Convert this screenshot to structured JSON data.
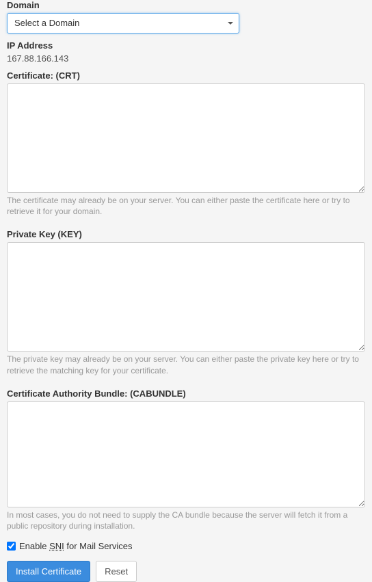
{
  "domain": {
    "label": "Domain",
    "placeholder": "Select a Domain"
  },
  "ip": {
    "label": "IP Address",
    "value": "167.88.166.143"
  },
  "crt": {
    "label": "Certificate: (CRT)",
    "value": "",
    "help": "The certificate may already be on your server. You can either paste the certificate here or try to retrieve it for your domain."
  },
  "key": {
    "label": "Private Key (KEY)",
    "value": "",
    "help": "The private key may already be on your server. You can either paste the private key here or try to retrieve the matching key for your certificate."
  },
  "cabundle": {
    "label": "Certificate Authority Bundle: (CABUNDLE)",
    "value": "",
    "help": "In most cases, you do not need to supply the CA bundle because the server will fetch it from a public repository during installation."
  },
  "sni": {
    "enable_prefix": "Enable ",
    "sni_text": "SNI",
    "enable_suffix": " for Mail Services",
    "checked": true
  },
  "buttons": {
    "install": "Install Certificate",
    "reset": "Reset"
  }
}
